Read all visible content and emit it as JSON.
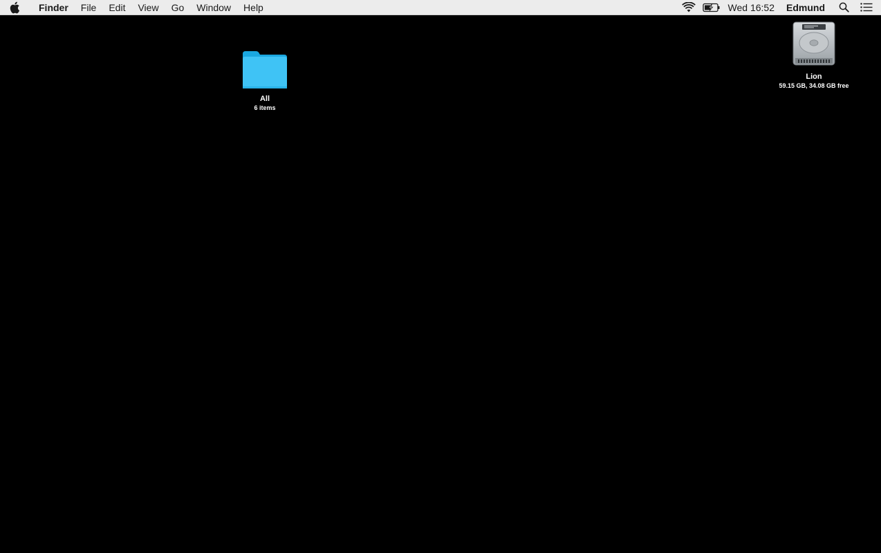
{
  "menubar": {
    "app_name": "Finder",
    "menus": [
      "File",
      "Edit",
      "View",
      "Go",
      "Window",
      "Help"
    ],
    "clock": "Wed 16:52",
    "user": "Edmund",
    "status_icons": [
      "wifi-icon",
      "battery-charging-icon",
      "spotlight-icon",
      "notification-center-icon"
    ]
  },
  "desktop": {
    "background_color": "#000000",
    "items": [
      {
        "name": "All",
        "info": "6 items",
        "icon": "folder-icon"
      },
      {
        "name": "Lion",
        "info": "59.15 GB, 34.08 GB free",
        "icon": "hard-drive-icon"
      }
    ]
  },
  "colors": {
    "menubar_bg": "#ececec",
    "folder_blue": "#3fc3f5"
  }
}
